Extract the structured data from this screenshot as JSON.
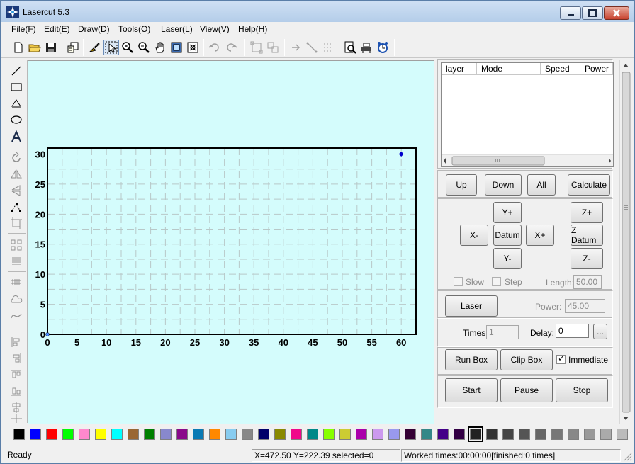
{
  "window": {
    "title": "Lasercut 5.3"
  },
  "menu": [
    "File(F)",
    "Edit(E)",
    "Draw(D)",
    "Tools(O)",
    "Laser(L)",
    "View(V)",
    "Help(H)"
  ],
  "toolbar_icons": [
    "new-file-icon",
    "open-folder-icon",
    "save-icon",
    "import-icon",
    "brush-icon",
    "select-arrow-icon",
    "zoom-in-icon",
    "zoom-out-icon",
    "pan-hand-icon",
    "fit-page-icon",
    "zoom-fit-icon",
    "undo-icon",
    "redo-icon",
    "group-icon",
    "ungroup-icon",
    "arrow-icon",
    "line-diagonal-icon",
    "array-icon",
    "preview-icon",
    "printer-icon",
    "clock-icon"
  ],
  "left_tools": [
    "line-tool-icon",
    "rectangle-tool-icon",
    "eraser-tool-icon",
    "ellipse-tool-icon",
    "text-tool-icon",
    "rotate-icon",
    "mirror-horizontal-icon",
    "mirror-vertical-icon",
    "nodes-icon",
    "crop-icon",
    "grid-array-icon",
    "align-icon",
    "hatch-icon",
    "cloud-icon",
    "curve-icon",
    "align-left-icon",
    "align-right-icon",
    "align-top-icon",
    "align-bottom-icon",
    "distribute-icon",
    "center-icon"
  ],
  "chart_data": {
    "type": "scatter",
    "x_ticks": [
      "0",
      "5",
      "10",
      "15",
      "20",
      "25",
      "30",
      "35",
      "40",
      "45",
      "50",
      "55",
      "60"
    ],
    "y_ticks": [
      "0",
      "5",
      "10",
      "15",
      "20",
      "25",
      "30"
    ],
    "xlim": [
      0,
      62.5
    ],
    "ylim": [
      0,
      31
    ],
    "grid": true,
    "points": [
      {
        "x": 60,
        "y": 30
      },
      {
        "x": 0,
        "y": 0
      }
    ],
    "colors": {
      "background": "#d4fcfc",
      "point": "#0000cc",
      "grid": "#b8c8c8"
    }
  },
  "layer_table": {
    "columns": [
      "layer",
      "Mode",
      "Speed",
      "Power"
    ]
  },
  "buttons": {
    "up": "Up",
    "down": "Down",
    "all": "All",
    "calculate": "Calculate",
    "y_plus": "Y+",
    "x_minus": "X-",
    "datum": "Datum",
    "x_plus": "X+",
    "y_minus": "Y-",
    "z_plus": "Z+",
    "z_datum": "Z Datum",
    "z_minus": "Z-",
    "laser": "Laser",
    "more": "...",
    "run_box": "Run Box",
    "clip_box": "Clip Box",
    "start": "Start",
    "pause": "Pause",
    "stop": "Stop"
  },
  "options": {
    "slow": "Slow",
    "step": "Step",
    "length_label": "Length:",
    "length_value": "50.00",
    "power_label": "Power:",
    "power_value": "45.00",
    "times_label": "Times:",
    "times_value": "1",
    "delay_label": "Delay:",
    "delay_value": "0",
    "immediate": "Immediate"
  },
  "palette": [
    "#000000",
    "#0000ff",
    "#ff0000",
    "#00ff00",
    "#ff88cc",
    "#ffff00",
    "#00ffff",
    "#996633",
    "#008000",
    "#8888cc",
    "#8a0a8a",
    "#0a7ab4",
    "#ff8800",
    "#88ccf0",
    "#888888",
    "#00006a",
    "#8a8a00",
    "#f0088a",
    "#008888",
    "#88ff00",
    "#cccc33",
    "#aa00aa",
    "#cc99ee",
    "#9999ee",
    "#330033",
    "#338888",
    "#440088",
    "#330044",
    "#222222",
    "#333333",
    "#444444",
    "#555555",
    "#666666",
    "#777777",
    "#888888",
    "#999999",
    "#aaaaaa",
    "#bbbbbb"
  ],
  "status": {
    "ready": "Ready",
    "coords": "X=472.50 Y=222.39 selected=0",
    "worked": "Worked times:00:00:00[finished:0 times]"
  }
}
